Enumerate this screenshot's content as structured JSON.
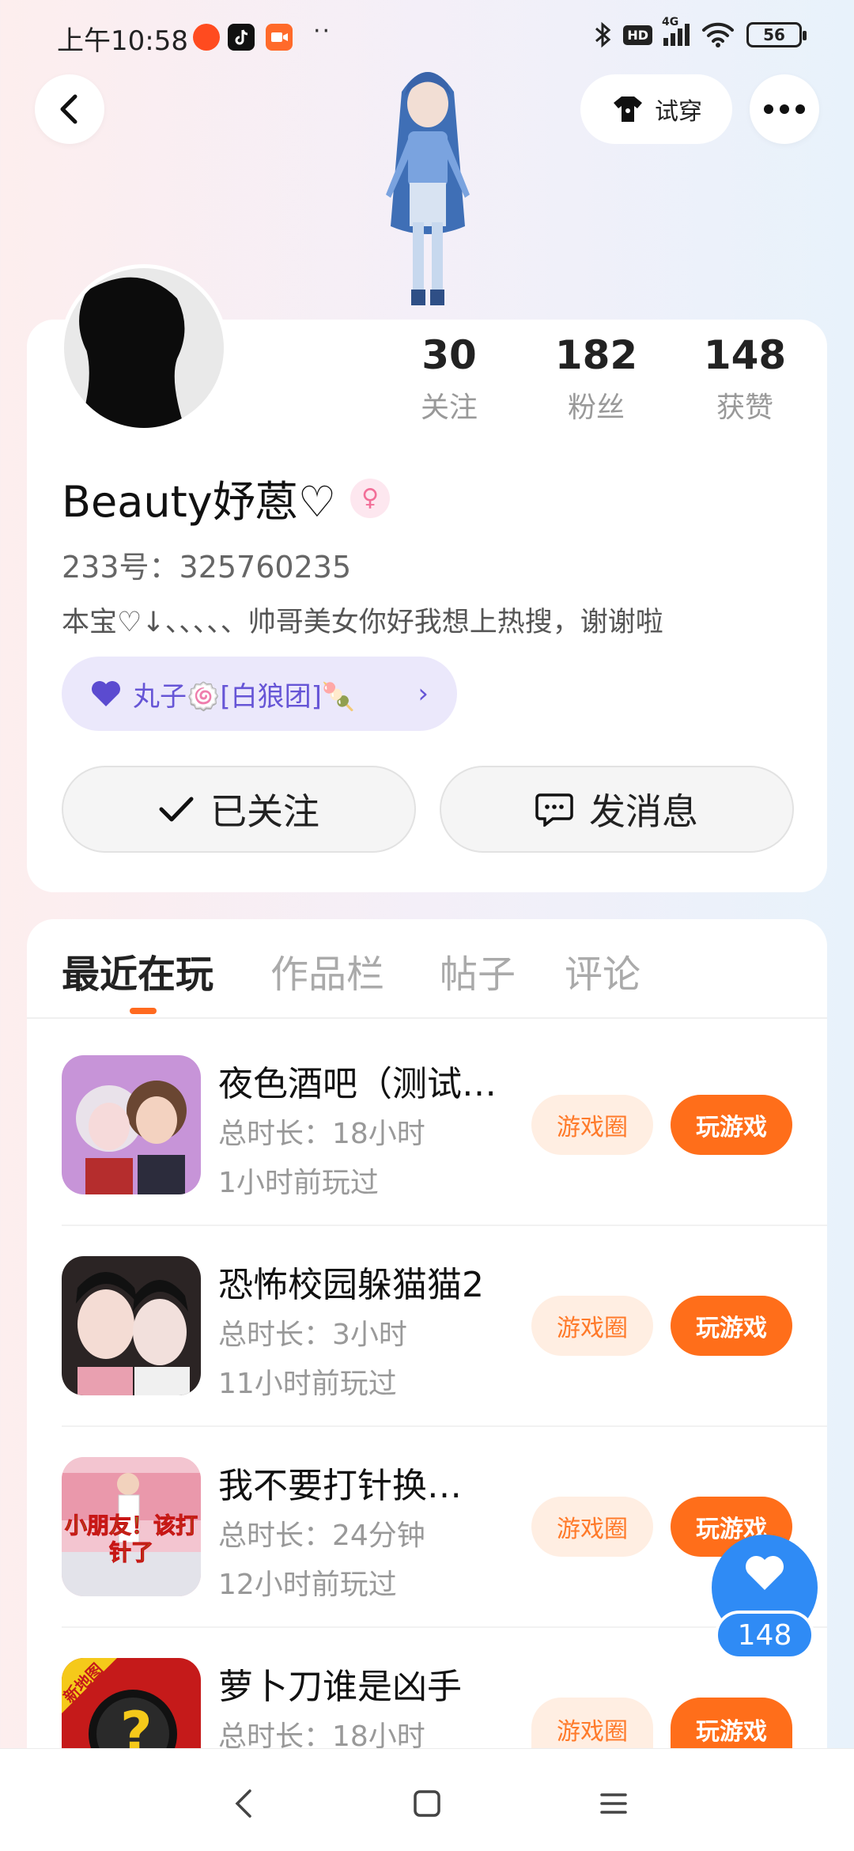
{
  "status_bar": {
    "time": "上午10:58",
    "battery": "56",
    "network": "4G",
    "hd": "HD",
    "more_indicator": "··"
  },
  "header": {
    "try_on_label": "试穿"
  },
  "profile": {
    "stats": [
      {
        "value": "30",
        "label": "关注"
      },
      {
        "value": "182",
        "label": "粉丝"
      },
      {
        "value": "148",
        "label": "获赞"
      }
    ],
    "nickname": "Beauty妤蒽♡",
    "uid": "233号：325760235",
    "bio": "本宝♡↓、、、、、帅哥美女你好我想上热搜，谢谢啦",
    "guild": "丸子🍥[白狼团]🍡",
    "followed_label": "已关注",
    "message_label": "发消息"
  },
  "tabs": [
    {
      "label": "最近在玩",
      "active": true
    },
    {
      "label": "作品栏",
      "active": false
    },
    {
      "label": "帖子",
      "active": false
    },
    {
      "label": "评论",
      "active": false
    }
  ],
  "games": [
    {
      "title": "夜色酒吧（测试…",
      "duration": "总时长：18小时",
      "last_played": "1小时前玩过",
      "circle": "游戏圈",
      "play": "玩游戏"
    },
    {
      "title": "恐怖校园躲猫猫2",
      "duration": "总时长：3小时",
      "last_played": "11小时前玩过",
      "circle": "游戏圈",
      "play": "玩游戏"
    },
    {
      "title": "我不要打针换…",
      "duration": "总时长：24分钟",
      "last_played": "12小时前玩过",
      "circle": "游戏圈",
      "play": "玩游戏",
      "icon_text": "小朋友！该打针了"
    },
    {
      "title": "萝卜刀谁是凶手",
      "duration": "总时长：18小时",
      "last_played": "",
      "circle": "游戏圈",
      "play": "玩游戏",
      "icon_badge": "新地图"
    }
  ],
  "like_float": {
    "count": "148"
  },
  "colors": {
    "accent_orange": "#ff6e1a",
    "accent_blue": "#2f8bf5",
    "guild_purple": "#6655d6"
  }
}
